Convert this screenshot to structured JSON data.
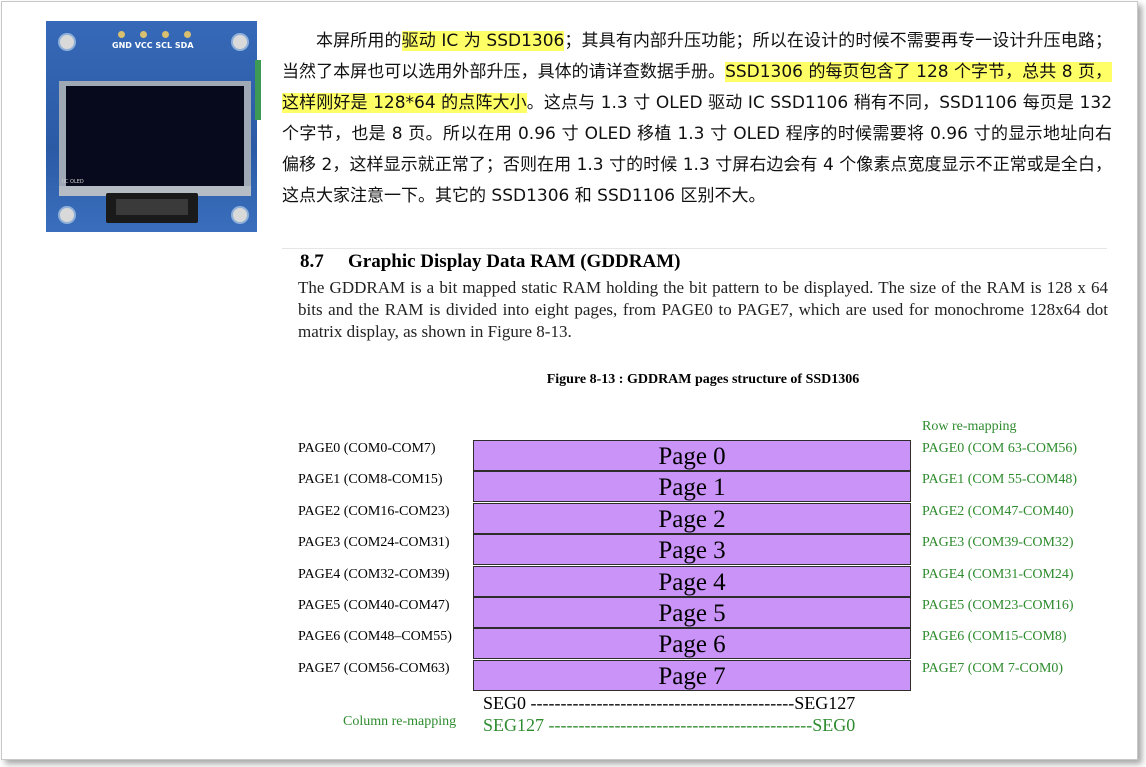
{
  "photo": {
    "pin_labels": "GND VCC SCL SDA",
    "tiny_text": "IIC\nOLED"
  },
  "chinese_paragraph": {
    "parts": [
      {
        "text": "本屏所用的",
        "highlight": false
      },
      {
        "text": "驱动 IC 为 SSD1306",
        "highlight": true
      },
      {
        "text": "；其具有内部升压功能；所以在设计的时候不需要再专一设计升压电路；当然了本屏也可以选用外部升压，具体的请详查数据手册。",
        "highlight": false
      },
      {
        "text": "SSD1306 的每页包含了 128 个字节，总共 8 页，这样刚好是 128*64 的点阵大小",
        "highlight": true
      },
      {
        "text": "。这点与 1.3 寸 OLED 驱动 IC SSD1106 稍有不同，SSD1106 每页是 132 个字节，也是 8 页。所以在用 0.96 寸 OLED 移植 1.3 寸 OLED 程序的时候需要将 0.96 寸的显示地址向右偏移 2，这样显示就正常了；否则在用 1.3 寸的时候 1.3 寸屏右边会有 4 个像素点宽度显示不正常或是全白，这点大家注意一下。其它的 SSD1306 和 SSD1106 区别不大。",
        "highlight": false
      }
    ]
  },
  "section": {
    "number": "8.7",
    "title": "Graphic Display Data RAM (GDDRAM)",
    "body": "The GDDRAM is a bit mapped static RAM holding the bit pattern to be displayed. The size of the RAM is 128 x 64 bits and the RAM is divided into eight pages, from PAGE0 to PAGE7, which are used for monochrome 128x64 dot matrix display, as shown in Figure 8-13."
  },
  "figure": {
    "caption": "Figure 8-13 : GDDRAM pages structure of SSD1306",
    "row_remap_label": "Row re-mapping",
    "pages": [
      {
        "left": "PAGE0 (COM0-COM7)",
        "box": "Page 0",
        "right": "PAGE0 (COM 63-COM56)"
      },
      {
        "left": "PAGE1 (COM8-COM15)",
        "box": "Page 1",
        "right": "PAGE1 (COM 55-COM48)"
      },
      {
        "left": "PAGE2 (COM16-COM23)",
        "box": "Page 2",
        "right": "PAGE2 (COM47-COM40)"
      },
      {
        "left": "PAGE3 (COM24-COM31)",
        "box": "Page 3",
        "right": "PAGE3 (COM39-COM32)"
      },
      {
        "left": "PAGE4 (COM32-COM39)",
        "box": "Page 4",
        "right": "PAGE4 (COM31-COM24)"
      },
      {
        "left": "PAGE5 (COM40-COM47)",
        "box": "Page 5",
        "right": "PAGE5 (COM23-COM16)"
      },
      {
        "left": "PAGE6 (COM48–COM55)",
        "box": "Page 6",
        "right": "PAGE6 (COM15-COM8)"
      },
      {
        "left": "PAGE7 (COM56-COM63)",
        "box": "Page 7",
        "right": "PAGE7 (COM 7-COM0)"
      }
    ],
    "seg_normal": "SEG0 --------------------------------------------SEG127",
    "seg_remap": "SEG127 --------------------------------------------SEG0",
    "column_remap_label": "Column re-mapping",
    "colors": {
      "page_fill": "#c993f8",
      "remap_text": "#2e8b2e",
      "highlight": "#ffff66"
    }
  }
}
